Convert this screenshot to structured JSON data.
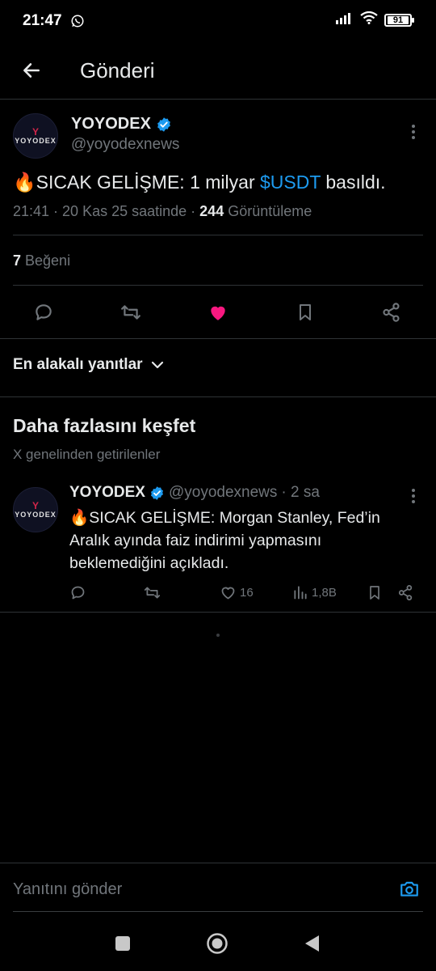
{
  "status_bar": {
    "time": "21:47",
    "battery": "91"
  },
  "header": {
    "title": "Gönderi"
  },
  "post": {
    "avatar_text": "YOYODEX",
    "display_name": "YOYODEX",
    "handle": "@yoyodexnews",
    "emoji": "🔥",
    "text_prefix": "SICAK GELİŞME: 1 milyar ",
    "cashtag": "$USDT",
    "text_suffix": " basıldı.",
    "time": "21:41",
    "date_sep": " · ",
    "date": "20 Kas 25 saatinde",
    "views_sep": " · ",
    "views_count": "244",
    "views_label": " Görüntüleme",
    "likes_count": "7",
    "likes_label": " Beğeni",
    "liked": true
  },
  "replies_filter": {
    "label": "En alakalı yanıtlar"
  },
  "explore": {
    "title": "Daha fazlasını keşfet",
    "subtitle": "X genelinden getirilenler"
  },
  "recommended": {
    "avatar_text": "YOYODEX",
    "display_name": "YOYODEX",
    "handle": "@yoyodexnews",
    "time_ago": "· 2 sa",
    "text": "🔥SICAK GELİŞME: Morgan Stanley, Fed’in Aralık ayında faiz indirimi yapmasını beklemediğini açıkladı.",
    "likes": "16",
    "views": "1,8B"
  },
  "reply_bar": {
    "placeholder": "Yanıtını gönder"
  },
  "colors": {
    "background": "#000000",
    "text": "#e7e9ea",
    "muted": "#71767b",
    "accent": "#1d9bf0",
    "like": "#f91880",
    "divider": "#2f3336"
  },
  "icons": {
    "back": "arrow-left-icon",
    "more": "more-vertical-icon",
    "verified": "verified-badge-icon",
    "reply": "reply-icon",
    "retweet": "retweet-icon",
    "like": "heart-icon",
    "bookmark": "bookmark-icon",
    "share": "share-icon",
    "views": "views-icon",
    "camera": "camera-icon"
  }
}
